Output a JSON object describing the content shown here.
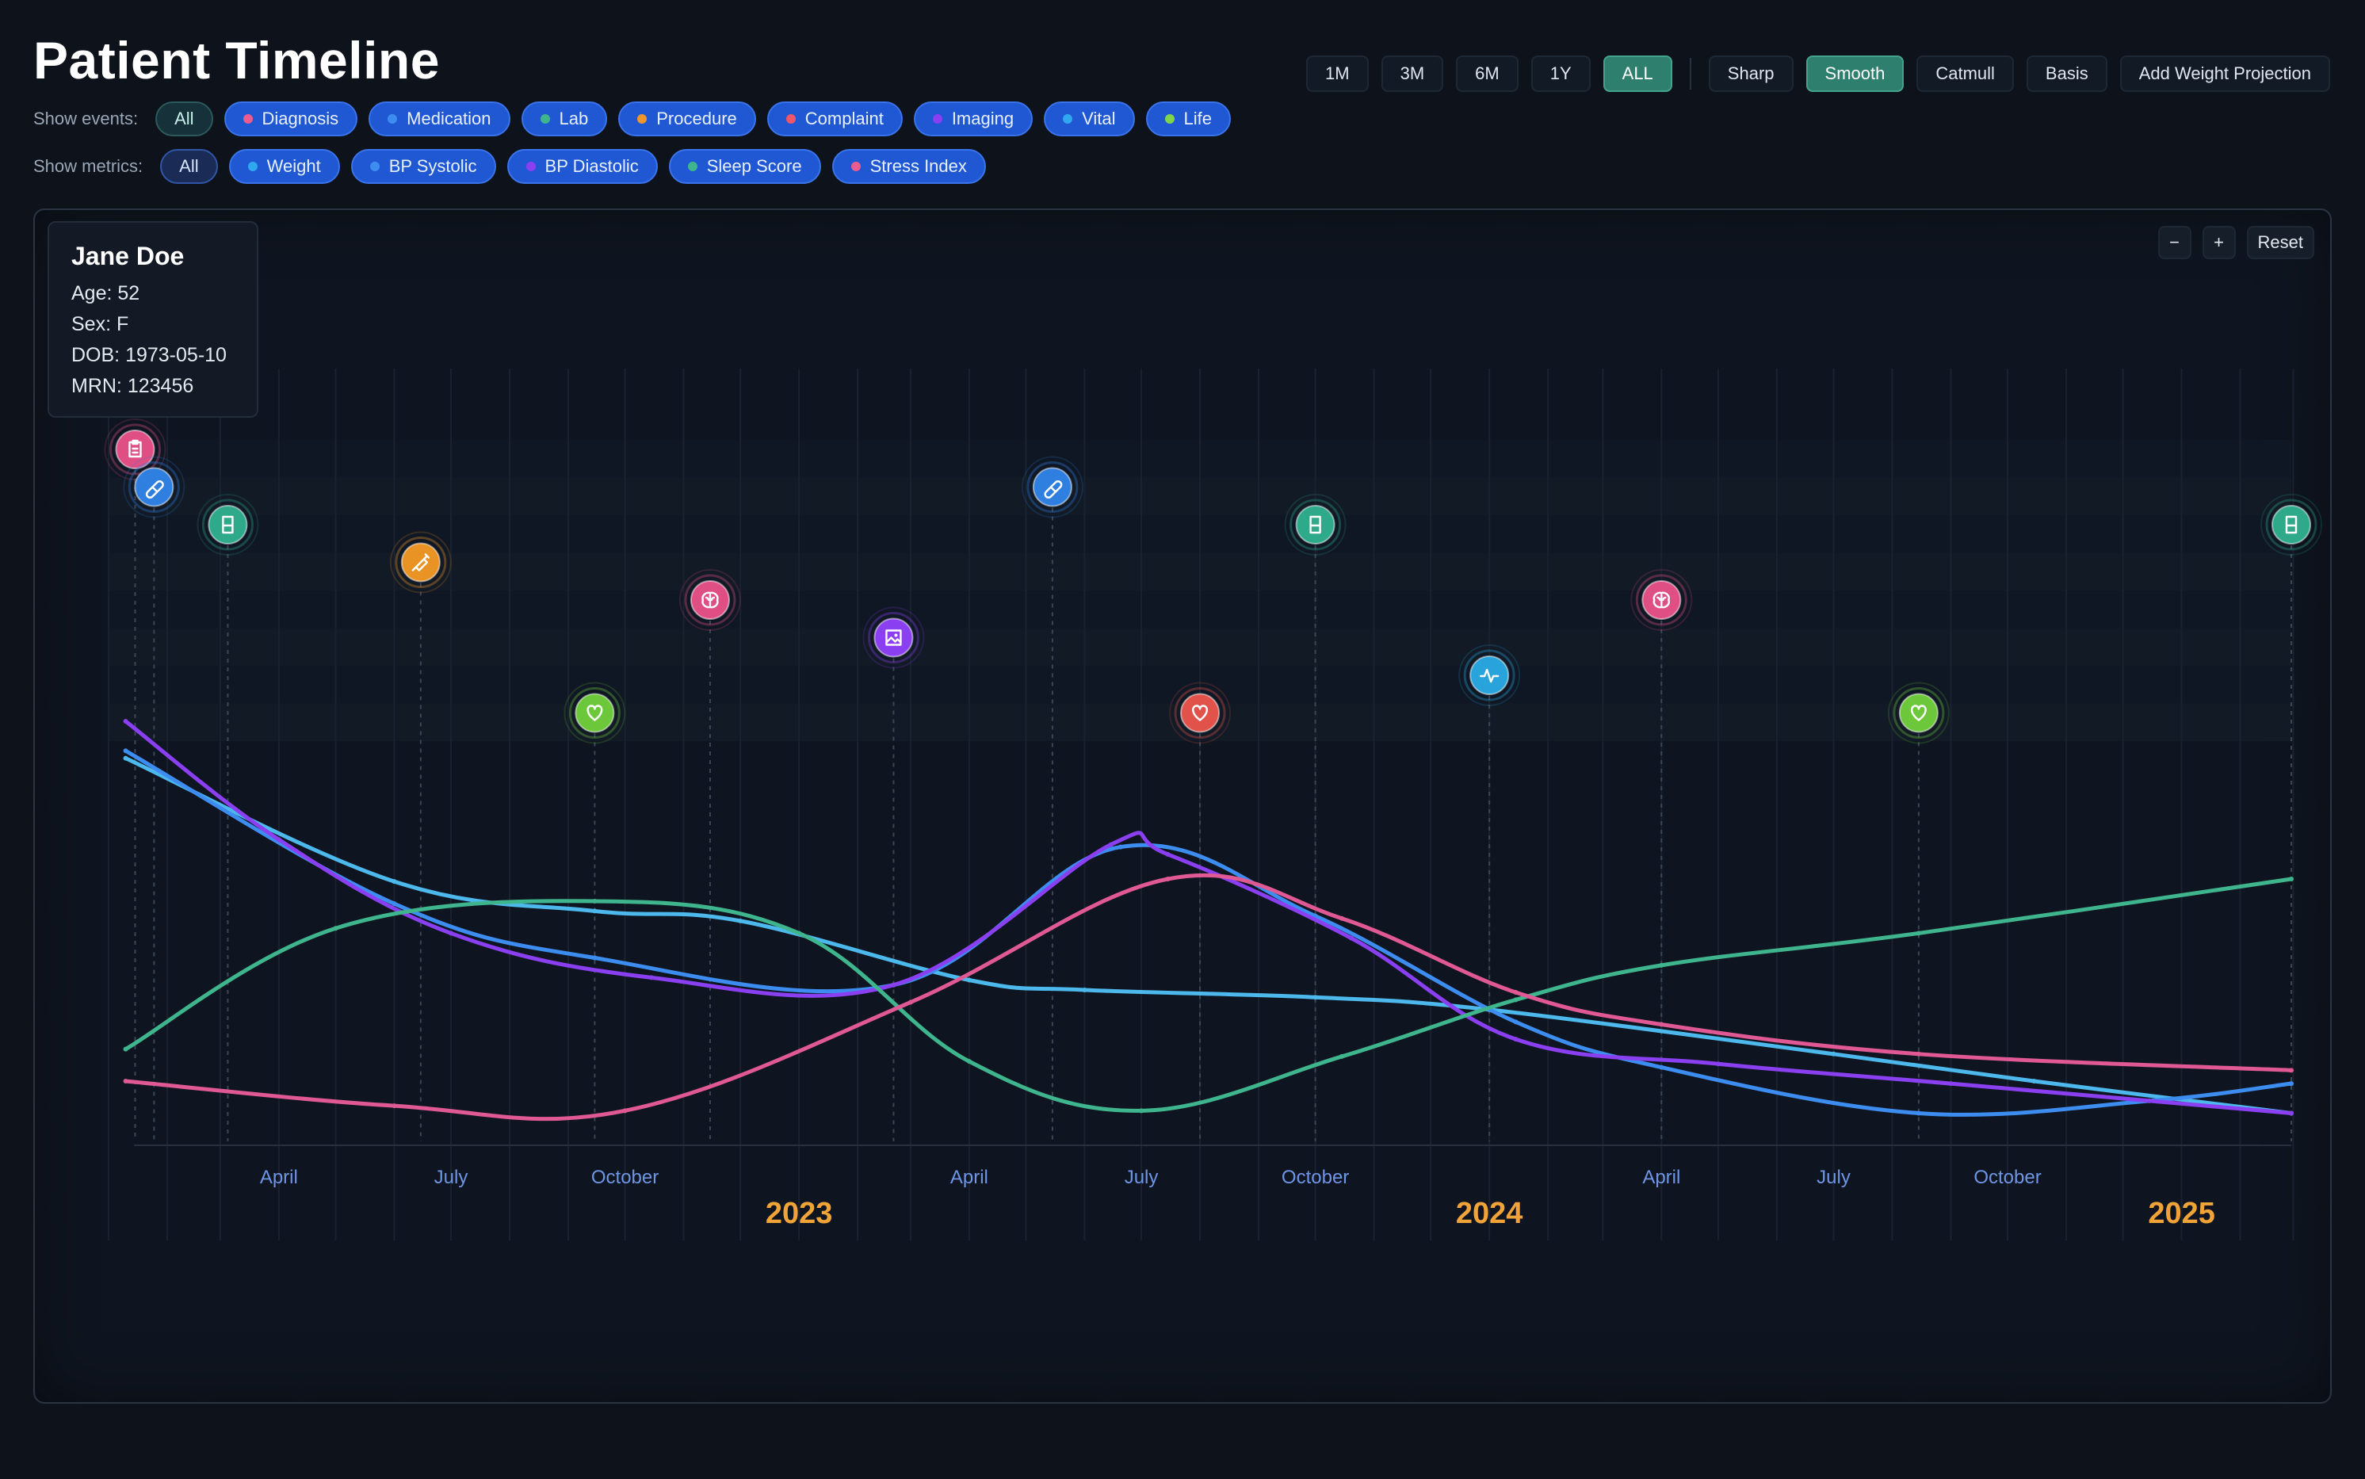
{
  "title": "Patient Timeline",
  "show_events": {
    "label": "Show events:",
    "all": "All",
    "items": [
      {
        "label": "Diagnosis",
        "color": "#ec5c91"
      },
      {
        "label": "Medication",
        "color": "#3d8df0"
      },
      {
        "label": "Lab",
        "color": "#3fb58e"
      },
      {
        "label": "Procedure",
        "color": "#f0962c"
      },
      {
        "label": "Complaint",
        "color": "#f0566a"
      },
      {
        "label": "Imaging",
        "color": "#8a3ff0"
      },
      {
        "label": "Vital",
        "color": "#2fa8f0"
      },
      {
        "label": "Life",
        "color": "#7fd64a"
      }
    ]
  },
  "show_metrics": {
    "label": "Show metrics:",
    "all": "All",
    "items": [
      {
        "label": "Weight",
        "color": "#2fa8f0"
      },
      {
        "label": "BP Systolic",
        "color": "#3d8df0"
      },
      {
        "label": "BP Diastolic",
        "color": "#8a3ff0"
      },
      {
        "label": "Sleep Score",
        "color": "#3fb58e"
      },
      {
        "label": "Stress Index",
        "color": "#ec5c91"
      }
    ]
  },
  "range_buttons": [
    "1M",
    "3M",
    "6M",
    "1Y",
    "ALL"
  ],
  "range_active": "ALL",
  "curve_buttons": [
    "Sharp",
    "Smooth",
    "Catmull",
    "Basis"
  ],
  "curve_active": "Smooth",
  "projection_button": "Add Weight Projection",
  "zoom": {
    "minus": "−",
    "plus": "+",
    "reset": "Reset"
  },
  "patient": {
    "name": "Jane Doe",
    "age": "Age: 52",
    "sex": "Sex: F",
    "dob": "DOB: 1973-05-10",
    "mrn": "MRN: 123456"
  },
  "chart_data": {
    "type": "line",
    "x_start": "2022-01-06",
    "x_end": "2025-02-28",
    "month_ticks": [
      {
        "date": "2022-04-01",
        "label": "April"
      },
      {
        "date": "2022-07-01",
        "label": "July"
      },
      {
        "date": "2022-10-01",
        "label": "October"
      },
      {
        "date": "2023-04-01",
        "label": "April"
      },
      {
        "date": "2023-07-01",
        "label": "July"
      },
      {
        "date": "2023-10-01",
        "label": "October"
      },
      {
        "date": "2024-04-01",
        "label": "April"
      },
      {
        "date": "2024-07-01",
        "label": "July"
      },
      {
        "date": "2024-10-01",
        "label": "October"
      }
    ],
    "year_ticks": [
      {
        "date": "2023-01-01",
        "label": "2023"
      },
      {
        "date": "2024-01-01",
        "label": "2024"
      },
      {
        "date": "2025-01-01",
        "label": "2025"
      }
    ],
    "grid": true,
    "series": [
      {
        "key": "weight",
        "color": "#4cb8ec",
        "points": [
          [
            "2022-01-10",
            0.745
          ],
          [
            "2022-06-01",
            0.495
          ],
          [
            "2022-09-15",
            0.435
          ],
          [
            "2022-12-01",
            0.415
          ],
          [
            "2023-04-01",
            0.295
          ],
          [
            "2023-06-01",
            0.275
          ],
          [
            "2023-10-01",
            0.26
          ],
          [
            "2024-01-01",
            0.235
          ],
          [
            "2024-07-01",
            0.145
          ],
          [
            "2024-10-15",
            0.09
          ],
          [
            "2025-02-28",
            0.025
          ]
        ]
      },
      {
        "key": "bp_systolic",
        "color": "#3d8df0",
        "points": [
          [
            "2022-01-10",
            0.76
          ],
          [
            "2022-06-01",
            0.45
          ],
          [
            "2022-09-15",
            0.34
          ],
          [
            "2023-02-20",
            0.285
          ],
          [
            "2023-06-20",
            0.565
          ],
          [
            "2023-10-01",
            0.425
          ],
          [
            "2024-01-15",
            0.21
          ],
          [
            "2024-04-01",
            0.118
          ],
          [
            "2024-08-15",
            0.025
          ],
          [
            "2024-12-15",
            0.05
          ],
          [
            "2025-02-28",
            0.085
          ]
        ]
      },
      {
        "key": "bp_diastolic",
        "color": "#8a3ff0",
        "points": [
          [
            "2022-01-10",
            0.82
          ],
          [
            "2022-04-01",
            0.58
          ],
          [
            "2022-07-01",
            0.39
          ],
          [
            "2022-10-15",
            0.3
          ],
          [
            "2023-02-20",
            0.285
          ],
          [
            "2023-06-15",
            0.57
          ],
          [
            "2023-07-15",
            0.55
          ],
          [
            "2023-10-20",
            0.38
          ],
          [
            "2024-01-15",
            0.175
          ],
          [
            "2024-05-01",
            0.125
          ],
          [
            "2024-09-01",
            0.085
          ],
          [
            "2025-02-28",
            0.025
          ]
        ]
      },
      {
        "key": "sleep_score",
        "color": "#3fb58e",
        "points": [
          [
            "2022-01-10",
            0.155
          ],
          [
            "2022-05-01",
            0.4
          ],
          [
            "2022-09-15",
            0.455
          ],
          [
            "2023-01-01",
            0.39
          ],
          [
            "2023-04-01",
            0.13
          ],
          [
            "2023-07-01",
            0.03
          ],
          [
            "2023-10-15",
            0.14
          ],
          [
            "2024-01-15",
            0.255
          ],
          [
            "2024-04-01",
            0.325
          ],
          [
            "2024-08-15",
            0.39
          ],
          [
            "2025-02-28",
            0.5
          ]
        ]
      },
      {
        "key": "stress_index",
        "color": "#e05994",
        "points": [
          [
            "2022-01-10",
            0.09
          ],
          [
            "2022-06-01",
            0.04
          ],
          [
            "2022-10-01",
            0.03
          ],
          [
            "2023-03-01",
            0.25
          ],
          [
            "2023-07-15",
            0.5
          ],
          [
            "2023-10-15",
            0.42
          ],
          [
            "2024-01-15",
            0.27
          ],
          [
            "2024-04-01",
            0.205
          ],
          [
            "2024-08-15",
            0.145
          ],
          [
            "2025-02-28",
            0.112
          ]
        ]
      }
    ],
    "events": [
      {
        "date": "2022-01-15",
        "type": "Diagnosis",
        "icon": "clipboard-icon",
        "row": 0
      },
      {
        "date": "2022-01-25",
        "type": "Medication",
        "icon": "pill-icon",
        "row": 1
      },
      {
        "date": "2022-03-05",
        "type": "Lab",
        "icon": "beaker-icon",
        "row": 2
      },
      {
        "date": "2022-06-15",
        "type": "Procedure",
        "icon": "syringe-icon",
        "row": 3
      },
      {
        "date": "2022-09-15",
        "type": "Life",
        "icon": "heart-icon",
        "row": 7
      },
      {
        "date": "2022-11-15",
        "type": "Diagnosis",
        "icon": "brain-icon",
        "row": 4
      },
      {
        "date": "2023-02-20",
        "type": "Imaging",
        "icon": "image-icon",
        "row": 5
      },
      {
        "date": "2023-05-15",
        "type": "Medication",
        "icon": "pill-icon",
        "row": 1
      },
      {
        "date": "2023-08-01",
        "type": "Complaint",
        "icon": "heart-icon",
        "row": 7
      },
      {
        "date": "2023-10-01",
        "type": "Lab",
        "icon": "beaker-icon",
        "row": 2
      },
      {
        "date": "2024-01-01",
        "type": "Vital",
        "icon": "pulse-icon",
        "row": 6
      },
      {
        "date": "2024-04-01",
        "type": "Diagnosis",
        "icon": "brain-icon",
        "row": 4
      },
      {
        "date": "2024-08-15",
        "type": "Life",
        "icon": "heart-icon",
        "row": 7
      },
      {
        "date": "2025-02-28",
        "type": "Lab",
        "icon": "beaker-icon",
        "row": 2
      }
    ],
    "event_colors": {
      "Diagnosis": "#e04f84",
      "Medication": "#2f7fe0",
      "Lab": "#2ea98a",
      "Procedure": "#e89324",
      "Complaint": "#e0524a",
      "Imaging": "#8a3ff0",
      "Vital": "#29a3dc",
      "Life": "#6cc73a"
    }
  }
}
